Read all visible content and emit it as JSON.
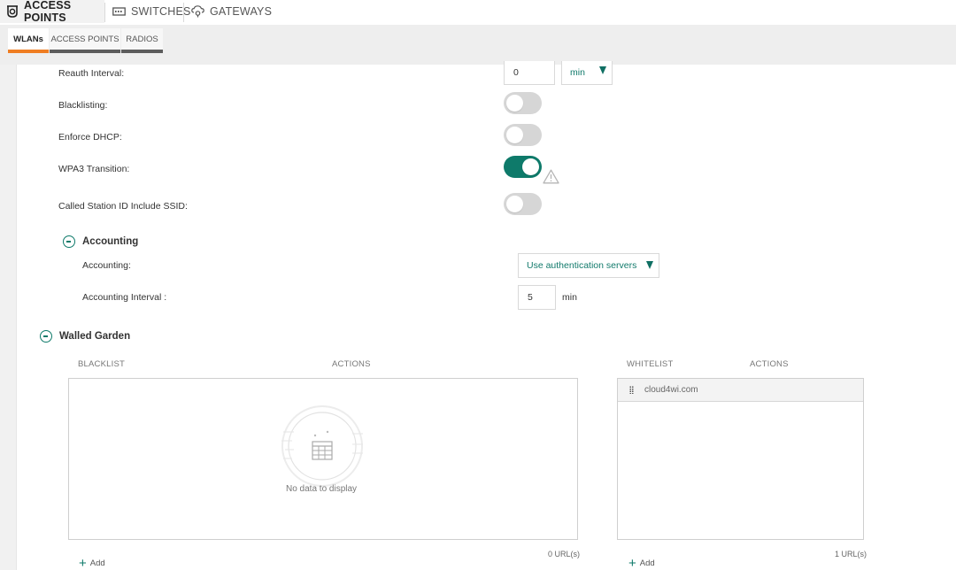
{
  "top_tabs": [
    {
      "label": "ACCESS POINTS",
      "icon": "access-point-icon",
      "active": true
    },
    {
      "label": "SWITCHES",
      "icon": "switch-icon",
      "active": false
    },
    {
      "label": "GATEWAYS",
      "icon": "gateway-icon",
      "active": false
    }
  ],
  "sub_tabs": [
    {
      "label": "WLANs",
      "active": true
    },
    {
      "label": "ACCESS POINTS",
      "active": false
    },
    {
      "label": "RADIOS",
      "active": false
    }
  ],
  "form": {
    "reauth": {
      "label": "Reauth Interval:",
      "value": "0",
      "unit": "min"
    },
    "blacklisting": {
      "label": "Blacklisting:",
      "on": false
    },
    "enforce_dhcp": {
      "label": "Enforce DHCP:",
      "on": false
    },
    "wpa3_transition": {
      "label": "WPA3 Transition:",
      "on": true,
      "warning_icon": "warning-icon"
    },
    "called_station": {
      "label": "Called Station ID Include SSID:",
      "on": false
    }
  },
  "accounting": {
    "title": "Accounting",
    "accounting_label": "Accounting:",
    "accounting_value": "Use authentication servers",
    "interval_label": "Accounting Interval :",
    "interval_value": "5",
    "interval_unit": "min"
  },
  "walled_garden": {
    "title": "Walled Garden",
    "blacklist": {
      "col_name": "BLACKLIST",
      "col_actions": "ACTIONS",
      "empty_text": "No data to display",
      "count": "0 URL(s)",
      "add_label": "Add"
    },
    "whitelist": {
      "col_name": "WHITELIST",
      "col_actions": "ACTIONS",
      "items": [
        "cloud4wi.com"
      ],
      "count": "1 URL(s)",
      "add_label": "Add"
    }
  },
  "colors": {
    "accent": "#0e7a6a",
    "tab_active": "#ef7d22"
  }
}
